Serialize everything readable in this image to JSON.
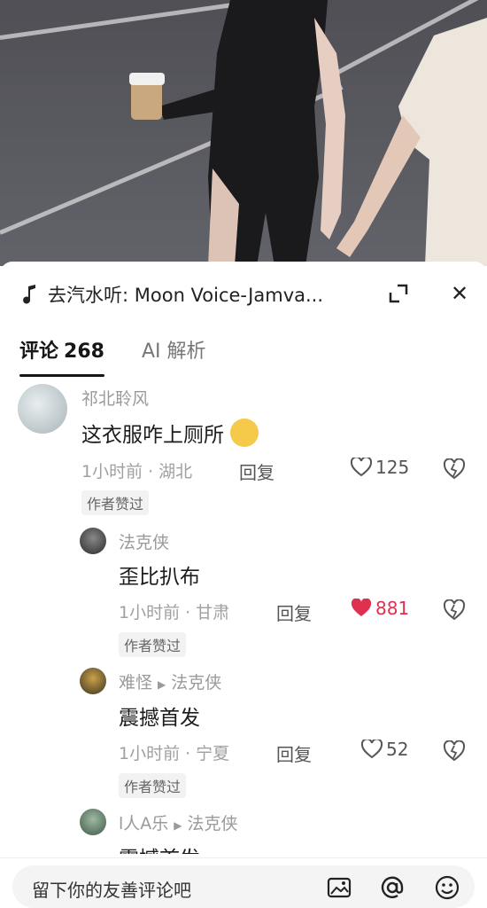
{
  "music": {
    "text": "去汽水听: Moon Voice-Jamva...",
    "icon": "music-note-icon"
  },
  "tabs": [
    {
      "label": "评论",
      "count": "268",
      "active": true
    },
    {
      "label": "AI 解析",
      "active": false
    }
  ],
  "comments": [
    {
      "user": "祁北聆风",
      "text": "这衣服咋上厕所",
      "emoji": "shush-face-emoji",
      "time": "1小时前",
      "location": "湖北",
      "reply_label": "回复",
      "likes": "125",
      "liked": false,
      "author_liked": "作者赞过"
    },
    {
      "user": "法克侠",
      "text": "歪比扒布",
      "time": "1小时前",
      "location": "甘肃",
      "reply_label": "回复",
      "likes": "881",
      "liked": true,
      "author_liked": "作者赞过"
    },
    {
      "user": "难怪",
      "reply_to": "法克侠",
      "text": "震撼首发",
      "time": "1小时前",
      "location": "宁夏",
      "reply_label": "回复",
      "likes": "52",
      "liked": false,
      "author_liked": "作者赞过"
    },
    {
      "user": "l人A乐",
      "reply_to": "法克侠",
      "text": "震撼首发"
    }
  ],
  "input": {
    "placeholder": "留下你的友善评论吧"
  },
  "colors": {
    "like_red": "#e0304f",
    "muted": "#a0a0a0"
  }
}
